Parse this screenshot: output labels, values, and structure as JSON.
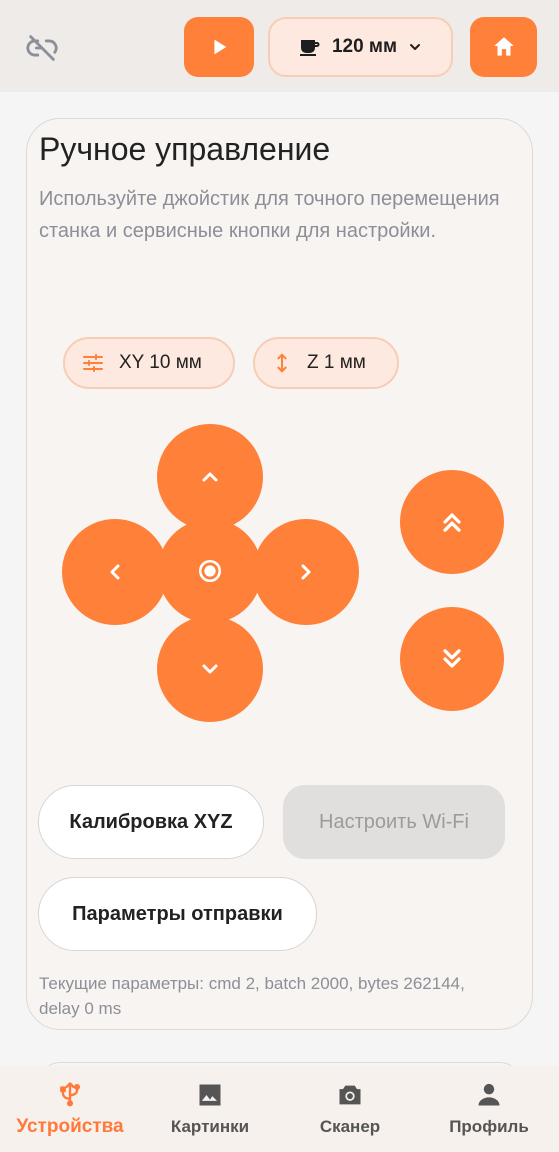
{
  "topbar": {
    "link_icon": "link-off-icon",
    "play_icon": "play-icon",
    "size_icon": "cup-icon",
    "size_label": "120 мм",
    "dropdown_icon": "chevron-down-icon",
    "home_icon": "home-icon",
    "accent_color": "#ff8038"
  },
  "card": {
    "title": "Ручное управление",
    "description": "Используйте джойстик для точного перемещения станка и сервисные кнопки для настройки.",
    "xy_step_icon": "sliders-icon",
    "xy_step_label": "XY 10 мм",
    "z_step_icon": "vertical-arrows-icon",
    "z_step_label": "Z 1 мм",
    "joystick": {
      "up_icon": "chevron-up-icon",
      "down_icon": "chevron-down-icon",
      "left_icon": "chevron-left-icon",
      "right_icon": "chevron-right-icon",
      "center_icon": "target-icon",
      "z_up_icon": "double-chevron-up-icon",
      "z_down_icon": "double-chevron-down-icon"
    },
    "calibrate_label": "Калибровка XYZ",
    "wifi_label": "Настроить Wi-Fi",
    "send_params_label": "Параметры отправки",
    "current_params": "Текущие параметры: cmd 2, batch 2000, bytes 262144, delay 0 ms"
  },
  "nav": {
    "items": [
      {
        "label": "Устройства",
        "icon": "usb-icon",
        "active": true
      },
      {
        "label": "Картинки",
        "icon": "image-icon",
        "active": false
      },
      {
        "label": "Сканер",
        "icon": "camera-icon",
        "active": false
      },
      {
        "label": "Профиль",
        "icon": "person-icon",
        "active": false
      }
    ]
  }
}
